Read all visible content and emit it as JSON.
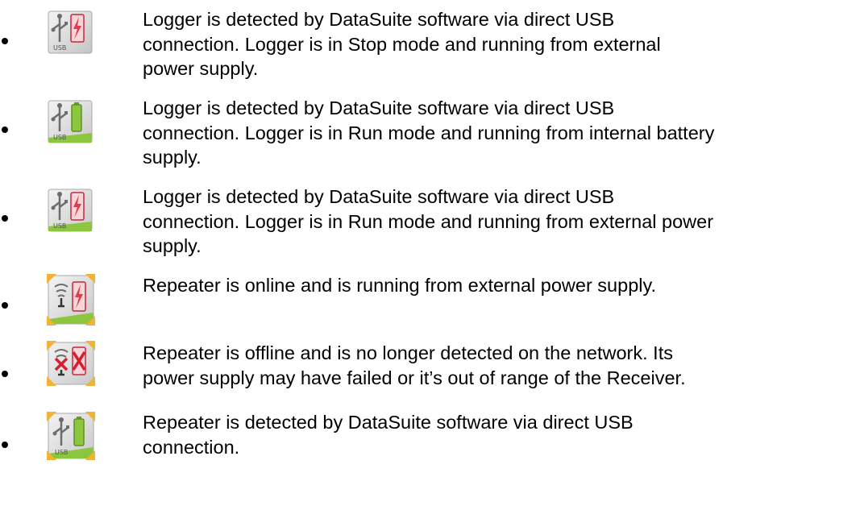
{
  "items": [
    {
      "icon": "usb-logger-external-power-stop-icon",
      "text": "Logger is detected by DataSuite software via direct USB\nconnection. Logger is in Stop mode and running from external\npower supply."
    },
    {
      "icon": "usb-logger-battery-run-icon",
      "text": "Logger is detected by DataSuite software via direct USB\nconnection. Logger is in Run mode and running from internal battery\nsupply."
    },
    {
      "icon": "usb-logger-external-power-run-icon",
      "text": "Logger is detected by DataSuite software via direct USB\nconnection. Logger is in Run mode and running from external power\nsupply."
    },
    {
      "icon": "repeater-online-external-power-icon",
      "text": "Repeater is online and is running from external power supply."
    },
    {
      "icon": "repeater-offline-icon",
      "text": "Repeater is offline and is no longer detected on the network. Its\npower supply may have failed or it’s out of range of the Receiver."
    },
    {
      "icon": "repeater-usb-battery-icon",
      "text": "Repeater is detected by DataSuite software via direct USB\nconnection."
    }
  ],
  "colors": {
    "icon_face": "#d8d8d8",
    "run_green": "#8cc63f",
    "power_red": "#e33b4d",
    "repeater_corner": "#f2b233",
    "usb_grey": "#6d6d6d"
  }
}
